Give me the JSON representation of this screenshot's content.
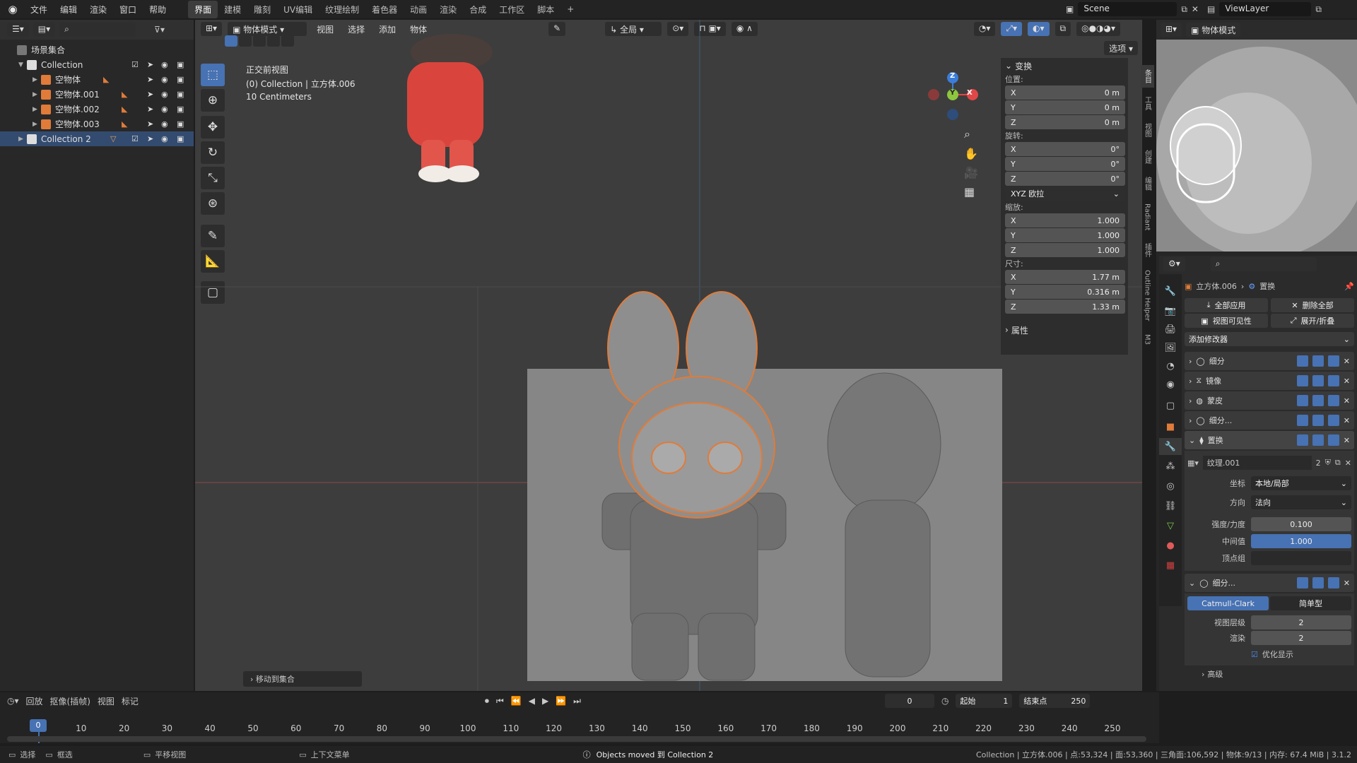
{
  "topbar": {
    "menus": [
      "文件",
      "编辑",
      "渲染",
      "窗口",
      "帮助"
    ],
    "workspaces": [
      "界面",
      "建模",
      "雕刻",
      "UV编辑",
      "纹理绘制",
      "着色器",
      "动画",
      "渲染",
      "合成",
      "工作区",
      "脚本"
    ],
    "active_workspace": "界面",
    "add_tab": "+",
    "scene": "Scene",
    "view_layer": "ViewLayer"
  },
  "outliner": {
    "root": "场景集合",
    "rows": [
      {
        "label": "Collection",
        "indent": 1
      },
      {
        "label": "空物体",
        "indent": 2
      },
      {
        "label": "空物体.001",
        "indent": 2
      },
      {
        "label": "空物体.002",
        "indent": 2
      },
      {
        "label": "空物体.003",
        "indent": 2
      },
      {
        "label": "Collection 2",
        "indent": 1
      }
    ]
  },
  "viewport": {
    "mode": "物体模式",
    "menus": [
      "视图",
      "选择",
      "添加",
      "物体"
    ],
    "transform_orientation": "全局",
    "options": "选项",
    "info_line1": "正交前视图",
    "info_line2": "(0) Collection | 立方体.006",
    "info_line3": "10 Centimeters",
    "last_op": "移动到集合",
    "gizmo": {
      "x": "X",
      "y": "Y",
      "z": "Z"
    }
  },
  "npanel": {
    "header": "变换",
    "location_label": "位置:",
    "location": [
      {
        "axis": "X",
        "value": "0 m"
      },
      {
        "axis": "Y",
        "value": "0 m"
      },
      {
        "axis": "Z",
        "value": "0 m"
      }
    ],
    "rotation_label": "旋转:",
    "rotation": [
      {
        "axis": "X",
        "value": "0°"
      },
      {
        "axis": "Y",
        "value": "0°"
      },
      {
        "axis": "Z",
        "value": "0°"
      }
    ],
    "rotation_mode": "XYZ 欧拉",
    "scale_label": "缩放:",
    "scale": [
      {
        "axis": "X",
        "value": "1.000"
      },
      {
        "axis": "Y",
        "value": "1.000"
      },
      {
        "axis": "Z",
        "value": "1.000"
      }
    ],
    "dims_label": "尺寸:",
    "dims": [
      {
        "axis": "X",
        "value": "1.77 m"
      },
      {
        "axis": "Y",
        "value": "0.316 m"
      },
      {
        "axis": "Z",
        "value": "1.33 m"
      }
    ],
    "properties": "属性",
    "side_tabs": [
      "条目",
      "工具",
      "视图",
      "创建",
      "编辑",
      "Radiant",
      "插件",
      "Outline Helper",
      "M3"
    ]
  },
  "properties": {
    "object": "立方体.006",
    "modifier_tab": "置换",
    "apply_all": "全部应用",
    "delete_all": "删除全部",
    "viewport_vis": "视图可见性",
    "expand": "展开/折叠",
    "add_modifier": "添加修改器",
    "modifiers": [
      "细分",
      "镜像",
      "蒙皮",
      "细分...",
      "置换"
    ],
    "texture": "纹理.001",
    "texture_users": "2",
    "coords_label": "坐标",
    "coords_value": "本地/局部",
    "direction_label": "方向",
    "direction_value": "法向",
    "strength_label": "强度/力度",
    "strength_value": "0.100",
    "midlevel_label": "中间值",
    "midlevel_value": "1.000",
    "vgroup_label": "顶点组",
    "subdiv": "细分...",
    "catmull": "Catmull-Clark",
    "simple": "简单型",
    "levels_label": "视图层级",
    "levels_value": "2",
    "render_label": "渲染",
    "render_value": "2",
    "optimal": "优化显示",
    "advanced": "高级"
  },
  "timeline": {
    "menus": [
      "回放",
      "抠像(插帧)",
      "视图",
      "标记"
    ],
    "current_frame": "0",
    "start_label": "起始",
    "start": "1",
    "end_label": "结束点",
    "end": "250",
    "ticks": [
      "0",
      "10",
      "20",
      "30",
      "40",
      "50",
      "60",
      "70",
      "80",
      "90",
      "100",
      "110",
      "120",
      "130",
      "140",
      "150",
      "160",
      "170",
      "180",
      "190",
      "200",
      "210",
      "220",
      "230",
      "240",
      "250"
    ]
  },
  "statusbar": {
    "select": "选择",
    "box": "框选",
    "pan": "平移视图",
    "context": "上下文菜单",
    "message": "Objects moved 到 Collection 2",
    "stats": "Collection | 立方体.006 | 点:53,324 | 面:53,360 | 三角面:106,592 | 物体:9/13 | 内存: 67.4 MiB | 3.1.2"
  }
}
